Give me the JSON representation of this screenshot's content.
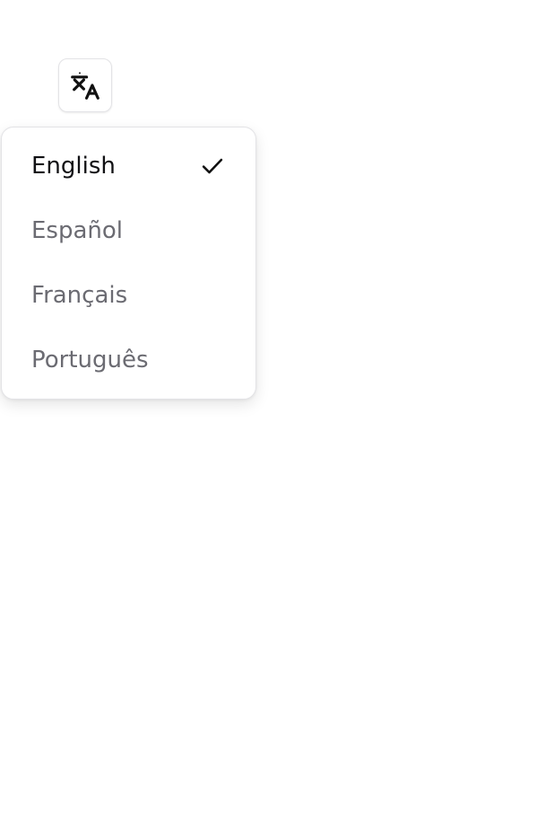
{
  "language_button": {
    "icon": "translate-icon"
  },
  "language_menu": {
    "items": [
      {
        "label": "English",
        "selected": true
      },
      {
        "label": "Español",
        "selected": false
      },
      {
        "label": "Français",
        "selected": false
      },
      {
        "label": "Português",
        "selected": false
      }
    ],
    "selected_icon": "checkmark-icon"
  }
}
